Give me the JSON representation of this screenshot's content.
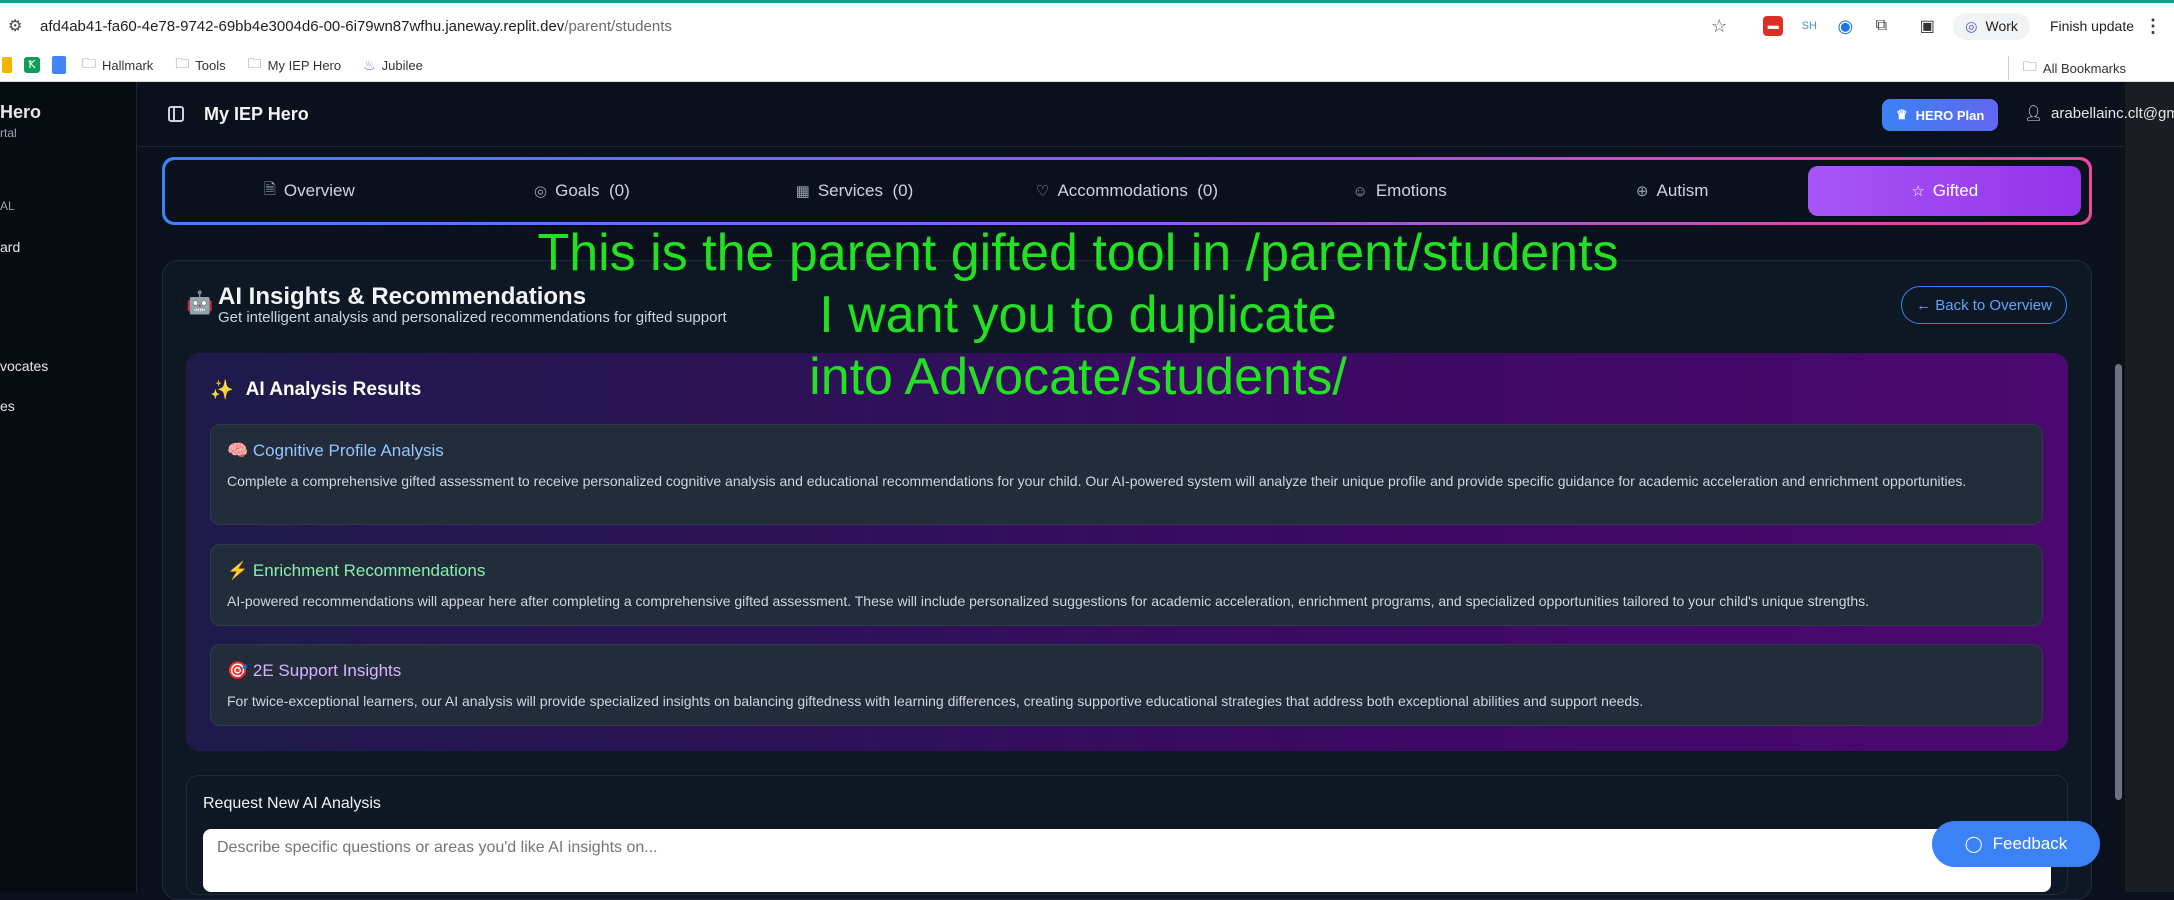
{
  "browser": {
    "url_host": "afd4ab41-fa60-4e78-9742-69bb4e3004d6-00-6i79wn87wfhu.janeway.replit.dev",
    "url_path": "/parent/students",
    "profile": "Work",
    "finish_update": "Finish update",
    "ext_sh": "SH",
    "bookmarks": [
      "Hallmark",
      "Tools",
      "My IEP Hero",
      "Jubilee"
    ],
    "all_bookmarks": "All Bookmarks"
  },
  "sidebar": {
    "brand_partial": "Hero",
    "brand_sub_partial": "rtal",
    "section_partial": "AL",
    "item1_partial": "ard",
    "item2_partial": "vocates",
    "item3_partial": "es"
  },
  "header": {
    "title": "My IEP Hero",
    "plan": "HERO Plan",
    "email": "arabellainc.clt@gmail.com"
  },
  "tabs": [
    {
      "label": "Overview",
      "icon": "document-icon"
    },
    {
      "label": "Goals  (0)",
      "icon": "target-icon"
    },
    {
      "label": "Services  (0)",
      "icon": "building-icon"
    },
    {
      "label": "Accommodations  (0)",
      "icon": "lightbulb-icon"
    },
    {
      "label": "Emotions",
      "icon": "smile-icon"
    },
    {
      "label": "Autism",
      "icon": "puzzle-icon"
    },
    {
      "label": "Gifted",
      "icon": "star-icon"
    }
  ],
  "annotation": {
    "line1": "This is the parent gifted tool in /parent/students",
    "line2": "I want you to duplicate",
    "line3": "into Advocate/students/"
  },
  "panel": {
    "title": "AI Insights & Recommendations",
    "subtitle": "Get intelligent analysis and personalized recommendations for gifted support",
    "back_button": "← Back to Overview",
    "results_title": "AI Analysis Results",
    "cards": [
      {
        "emoji": "🧠",
        "title": "Cognitive Profile Analysis",
        "color": "#93c5fd",
        "body": "Complete a comprehensive gifted assessment to receive personalized cognitive analysis and educational recommendations for your child. Our AI-powered system will analyze their unique profile and provide specific guidance for academic acceleration and enrichment opportunities."
      },
      {
        "emoji": "⚡",
        "title": "Enrichment Recommendations",
        "color": "#86efac",
        "body": "AI-powered recommendations will appear here after completing a comprehensive gifted assessment. These will include personalized suggestions for academic acceleration, enrichment programs, and specialized opportunities tailored to your child's unique strengths."
      },
      {
        "emoji": "🎯",
        "title": "2E Support Insights",
        "color": "#d8b4fe",
        "body": "For twice-exceptional learners, our AI analysis will provide specialized insights on balancing giftedness with learning differences, creating supportive educational strategies that address both exceptional abilities and support needs."
      }
    ],
    "request_label": "Request New AI Analysis",
    "request_placeholder": "Describe specific questions or areas you'd like AI insights on..."
  },
  "feedback": "Feedback"
}
